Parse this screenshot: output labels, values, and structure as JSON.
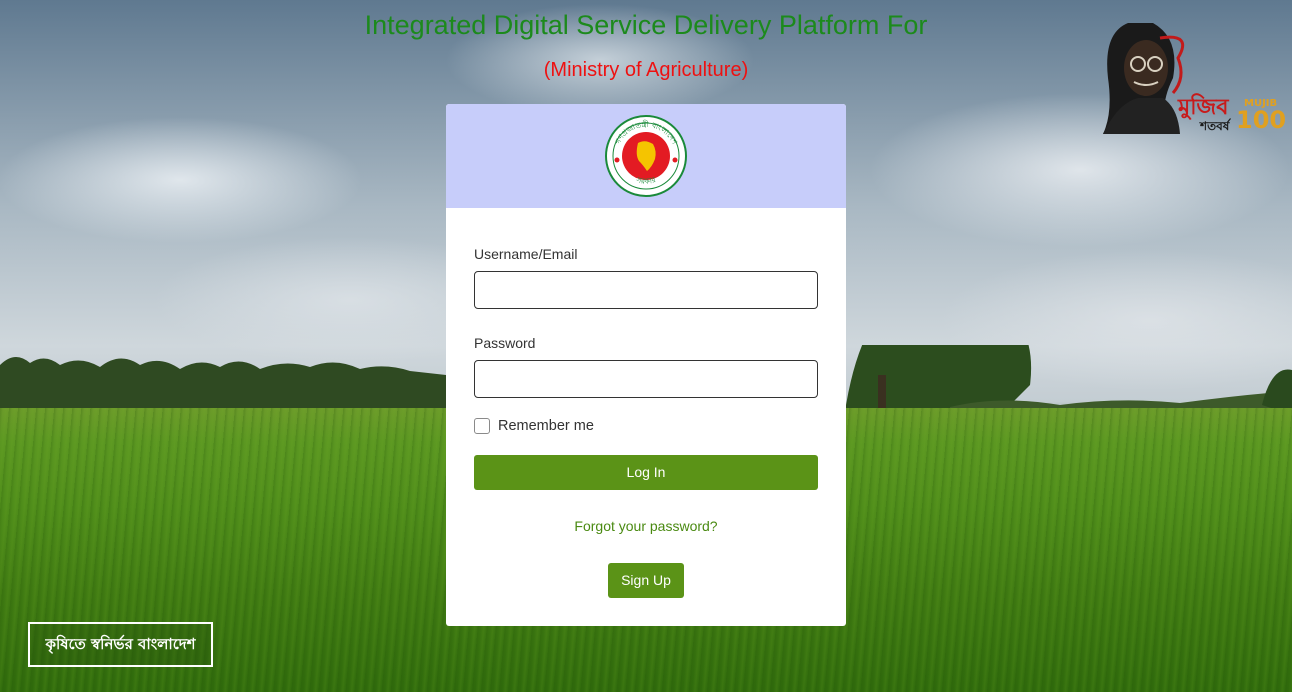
{
  "header": {
    "title": "Integrated Digital Service Delivery Platform For",
    "subtitle": "(Ministry of Agriculture)"
  },
  "badge": {
    "bengali": "মুজিব",
    "bengali_sub": "শতবর্ষ",
    "english": "MUJIB",
    "number": "100"
  },
  "emblem": {
    "top_text": "গণপ্রজাতন্ত্রী বাংলাদেশ",
    "bottom_text": "সরকার"
  },
  "login": {
    "username_label": "Username/Email",
    "username_value": "",
    "password_label": "Password",
    "password_value": "",
    "remember_label": "Remember me",
    "login_button": "Log In",
    "forgot_link": "Forgot your password?",
    "signup_button": "Sign Up"
  },
  "footer": {
    "slogan": "কৃষিতে স্বনির্ভর বাংলাদেশ"
  },
  "colors": {
    "title_green": "#1c8a1c",
    "subtitle_red": "#ee1111",
    "button_green": "#5b9317",
    "header_lavender": "#c7cdfa"
  }
}
